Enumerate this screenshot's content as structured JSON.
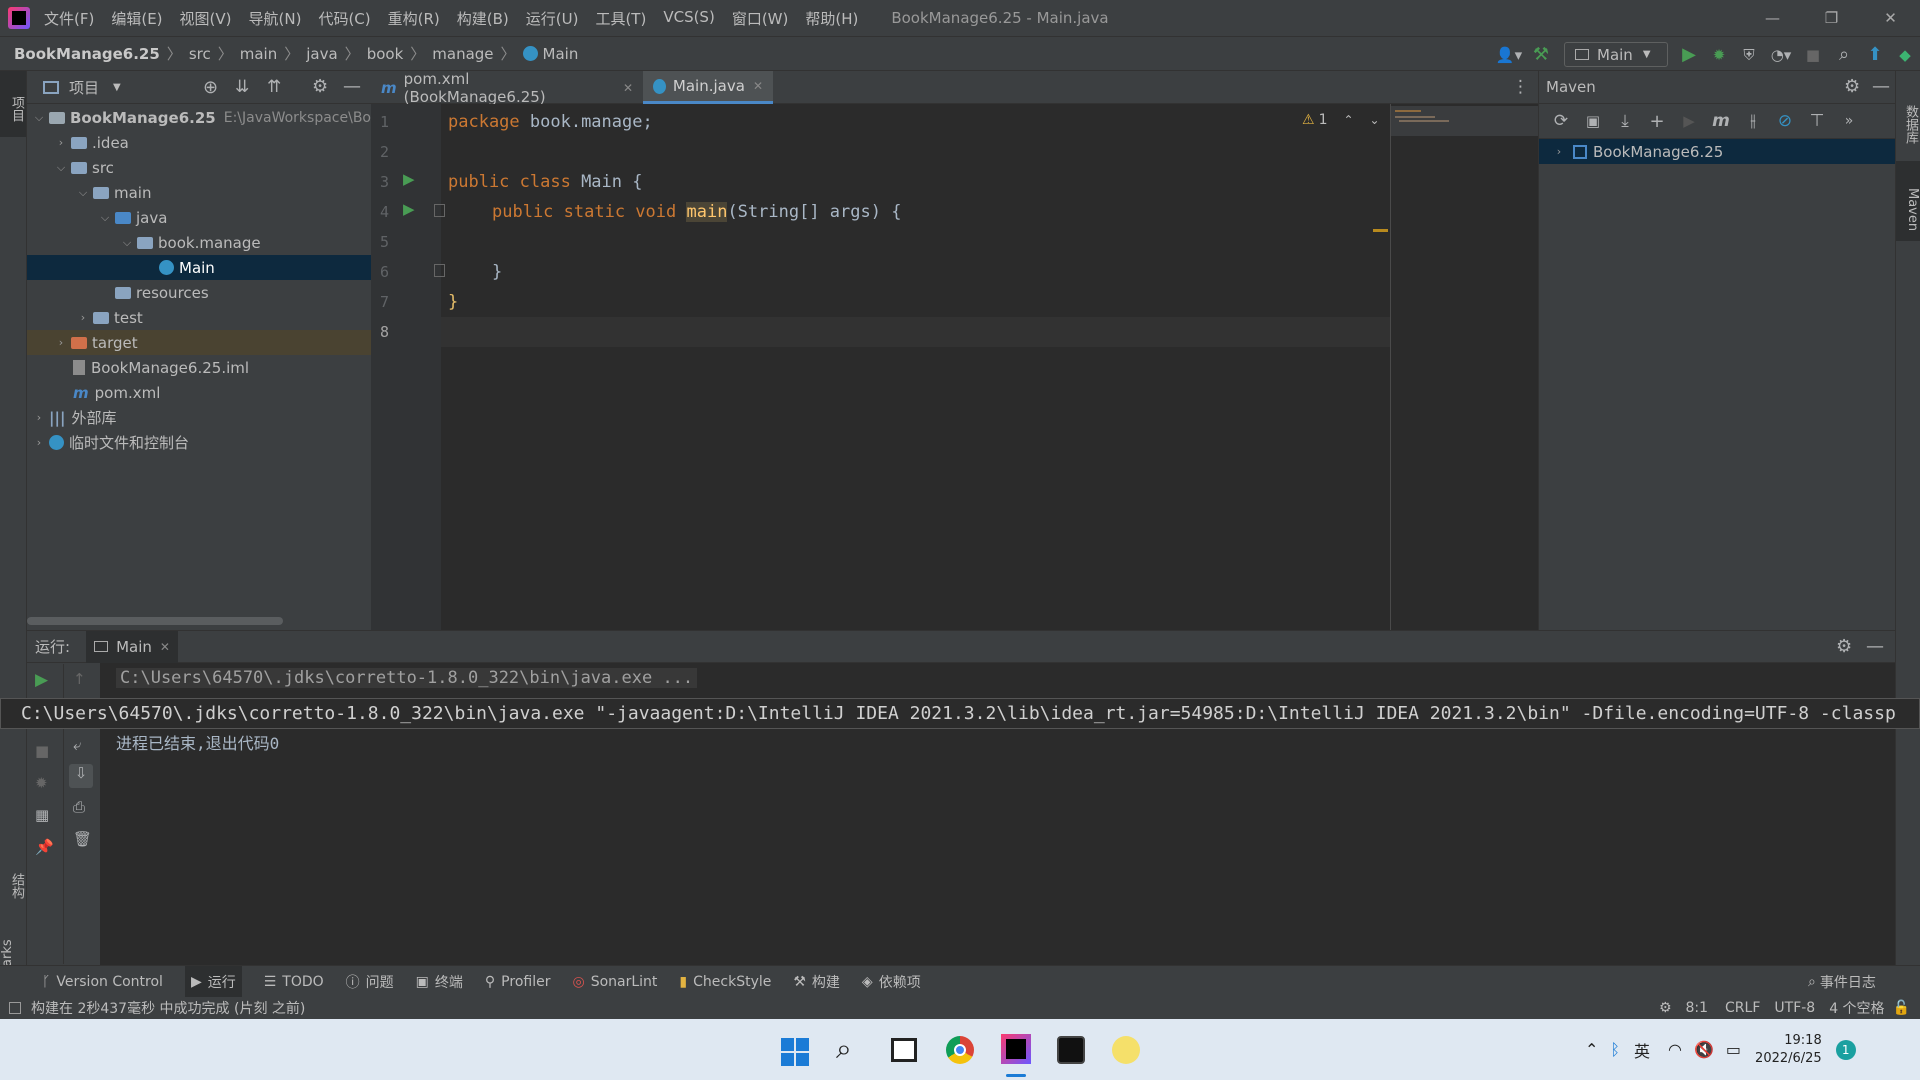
{
  "titlebar": {
    "menu": [
      "文件(F)",
      "编辑(E)",
      "视图(V)",
      "导航(N)",
      "代码(C)",
      "重构(R)",
      "构建(B)",
      "运行(U)",
      "工具(T)",
      "VCS(S)",
      "窗口(W)",
      "帮助(H)"
    ],
    "window_title": "BookManage6.25 - Main.java"
  },
  "navbar": {
    "breadcrumbs": [
      "BookManage6.25",
      "src",
      "main",
      "java",
      "book",
      "manage",
      "Main"
    ],
    "run_config": "Main"
  },
  "left_stripe": {
    "project_label": "项目",
    "structure_label": "结构",
    "bookmarks_label": "Bookmarks"
  },
  "right_stripe": {
    "database_label": "数据库",
    "maven_label": "Maven"
  },
  "project_panel": {
    "title": "项目",
    "tree": [
      {
        "label": "BookManage6.25",
        "hint": "E:\\JavaWorkspace\\Bo",
        "indent": 0,
        "arrow": "open",
        "icon": "module-folder-icon",
        "bold": true
      },
      {
        "label": ".idea",
        "indent": 1,
        "arrow": "closed",
        "icon": "folder-icon"
      },
      {
        "label": "src",
        "indent": 1,
        "arrow": "open",
        "icon": "folder-icon"
      },
      {
        "label": "main",
        "indent": 2,
        "arrow": "open",
        "icon": "folder-icon"
      },
      {
        "label": "java",
        "indent": 3,
        "arrow": "open",
        "icon": "source-folder-icon"
      },
      {
        "label": "book.manage",
        "indent": 4,
        "arrow": "open",
        "icon": "package-icon"
      },
      {
        "label": "Main",
        "indent": 5,
        "arrow": "",
        "icon": "class-icon",
        "selected": true
      },
      {
        "label": "resources",
        "indent": 3,
        "arrow": "",
        "icon": "resources-folder-icon"
      },
      {
        "label": "test",
        "indent": 2,
        "arrow": "closed",
        "icon": "folder-icon"
      },
      {
        "label": "target",
        "indent": 1,
        "arrow": "closed",
        "icon": "excluded-folder-icon",
        "highlight": true
      },
      {
        "label": "BookManage6.25.iml",
        "indent": 1,
        "arrow": "",
        "icon": "iml-file-icon"
      },
      {
        "label": "pom.xml",
        "indent": 1,
        "arrow": "",
        "icon": "maven-file-icon"
      },
      {
        "label": "外部库",
        "indent": 0,
        "arrow": "closed",
        "icon": "library-icon"
      },
      {
        "label": "临时文件和控制台",
        "indent": 0,
        "arrow": "closed",
        "icon": "scratch-icon"
      }
    ]
  },
  "editor": {
    "tabs": [
      {
        "label": "pom.xml (BookManage6.25)",
        "active": false
      },
      {
        "label": "Main.java",
        "active": true
      }
    ],
    "warnings": "1",
    "line_numbers": [
      "1",
      "2",
      "3",
      "4",
      "5",
      "6",
      "7",
      "8"
    ],
    "lines": {
      "l1_kw": "package",
      "l1_rest": " book.manage;",
      "l3_kw": "public class",
      "l3_rest": " Main {",
      "l4_kw": "public static void",
      "l4_method": "main",
      "l4_rest": "(String[] args) {",
      "l6": "}",
      "l7": "}"
    }
  },
  "maven": {
    "title": "Maven",
    "project": "BookManage6.25"
  },
  "run_panel": {
    "label": "运行:",
    "tab": "Main",
    "console_header": "C:\\Users\\64570\\.jdks\\corretto-1.8.0_322\\bin\\java.exe ...",
    "full_command": "C:\\Users\\64570\\.jdks\\corretto-1.8.0_322\\bin\\java.exe \"-javaagent:D:\\IntelliJ IDEA 2021.3.2\\lib\\idea_rt.jar=54985:D:\\IntelliJ IDEA 2021.3.2\\bin\" -Dfile.encoding=UTF-8 -classp",
    "exit_line": "进程已结束,退出代码0"
  },
  "bottom_tabs": [
    "Version Control",
    "运行",
    "TODO",
    "问题",
    "终端",
    "Profiler",
    "SonarLint",
    "CheckStyle",
    "构建",
    "依赖项"
  ],
  "event_log": "事件日志",
  "statusbar": {
    "message": "构建在 2秒437毫秒 中成功完成 (片刻 之前)",
    "position": "8:1",
    "line_sep": "CRLF",
    "encoding": "UTF-8",
    "indent": "4 个空格"
  },
  "taskbar": {
    "ime": "英",
    "time": "19:18",
    "date": "2022/6/25",
    "notifications": "1"
  },
  "colors": {
    "accent": "#4a88c7",
    "keyword": "#cc7832",
    "selection": "#0d293e",
    "taskbar": "#dfe8f2"
  }
}
